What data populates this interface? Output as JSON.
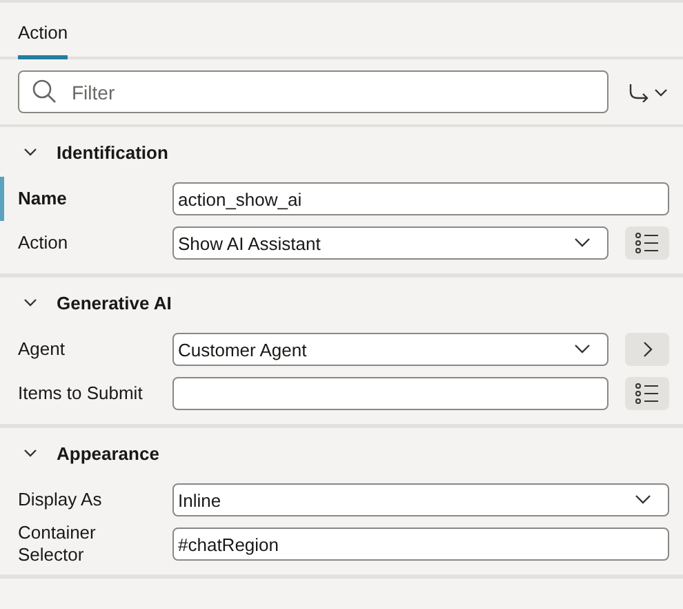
{
  "tabs": [
    {
      "label": "Action",
      "selected": true
    }
  ],
  "filter": {
    "placeholder": "Filter"
  },
  "sections": [
    {
      "title": "Identification",
      "expanded": true,
      "fields": [
        {
          "label": "Name",
          "kind": "text",
          "value": "action_show_ai",
          "selected": true
        },
        {
          "label": "Action",
          "kind": "select",
          "value": "Show AI Assistant",
          "selected": false,
          "side_button": {
            "kind": "list"
          }
        }
      ]
    },
    {
      "title": "Generative AI",
      "expanded": true,
      "fields": [
        {
          "label": "Agent",
          "kind": "select",
          "value": "Customer Agent",
          "selected": false,
          "side_button": {
            "kind": "next"
          }
        },
        {
          "label": "Items to Submit",
          "kind": "text",
          "selected": false,
          "side_button": {
            "kind": "list"
          }
        }
      ]
    },
    {
      "title": "Appearance",
      "expanded": true,
      "fields": [
        {
          "label": "Display As",
          "kind": "select",
          "value": "Inline",
          "selected": false
        },
        {
          "label": "Container Selector",
          "kind": "text",
          "value": "#chatRegion",
          "selected": false
        }
      ]
    }
  ]
}
